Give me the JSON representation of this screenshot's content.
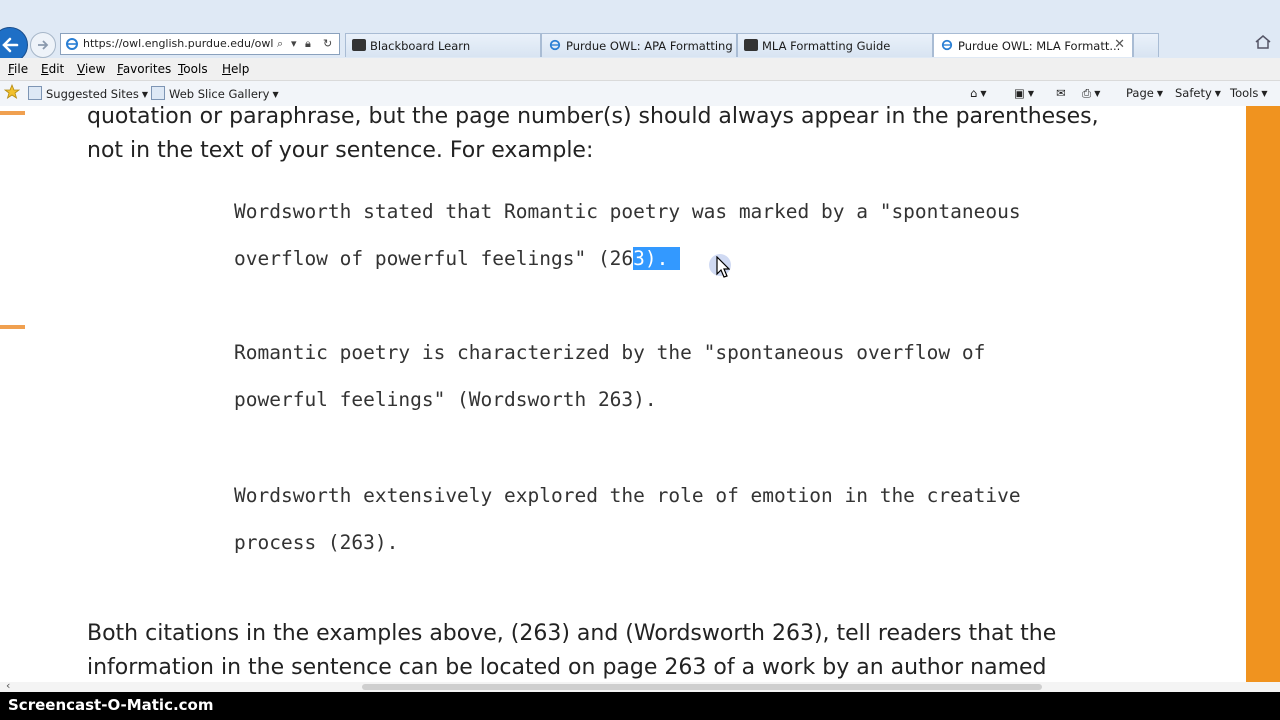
{
  "browser": {
    "address_url": "https://owl.english.purdue.edu/owl/",
    "tabs": [
      {
        "label": "Blackboard Learn"
      },
      {
        "label": "Purdue OWL: APA Formatting ..."
      },
      {
        "label": "MLA Formatting Guide"
      },
      {
        "label": "Purdue OWL: MLA Formatt..."
      }
    ],
    "menu": [
      "File",
      "Edit",
      "View",
      "Favorites",
      "Tools",
      "Help"
    ],
    "favorites": {
      "suggested": "Suggested Sites",
      "webslice": "Web Slice Gallery"
    },
    "commands": {
      "page": "Page",
      "safety": "Safety",
      "tools": "Tools"
    }
  },
  "content": {
    "para1_line1": "quotation or paraphrase, but the page number(s) should always appear in the parentheses,",
    "para1_line2": "not in the text of your sentence. For example:",
    "ex1_line1": "Wordsworth stated that Romantic poetry was marked by a \"spontaneous",
    "ex1_line2_a": "overflow of powerful feelings\" (26",
    "ex1_line2_sel": "3).",
    "ex2_line1": "Romantic poetry is characterized by the \"spontaneous overflow of",
    "ex2_line2": "powerful feelings\" (Wordsworth 263).",
    "ex3_line1": "Wordsworth extensively explored the role of emotion in the creative",
    "ex3_line2": "process (263).",
    "para2_line1": "Both citations in the examples above, (263) and (Wordsworth 263), tell readers that the",
    "para2_line2": "information in the sentence can be located on page 263 of a work by an author named"
  },
  "watermark": "Screencast-O-Matic.com",
  "colors": {
    "accent_orange": "#f0931f",
    "selection": "#3399ff"
  }
}
